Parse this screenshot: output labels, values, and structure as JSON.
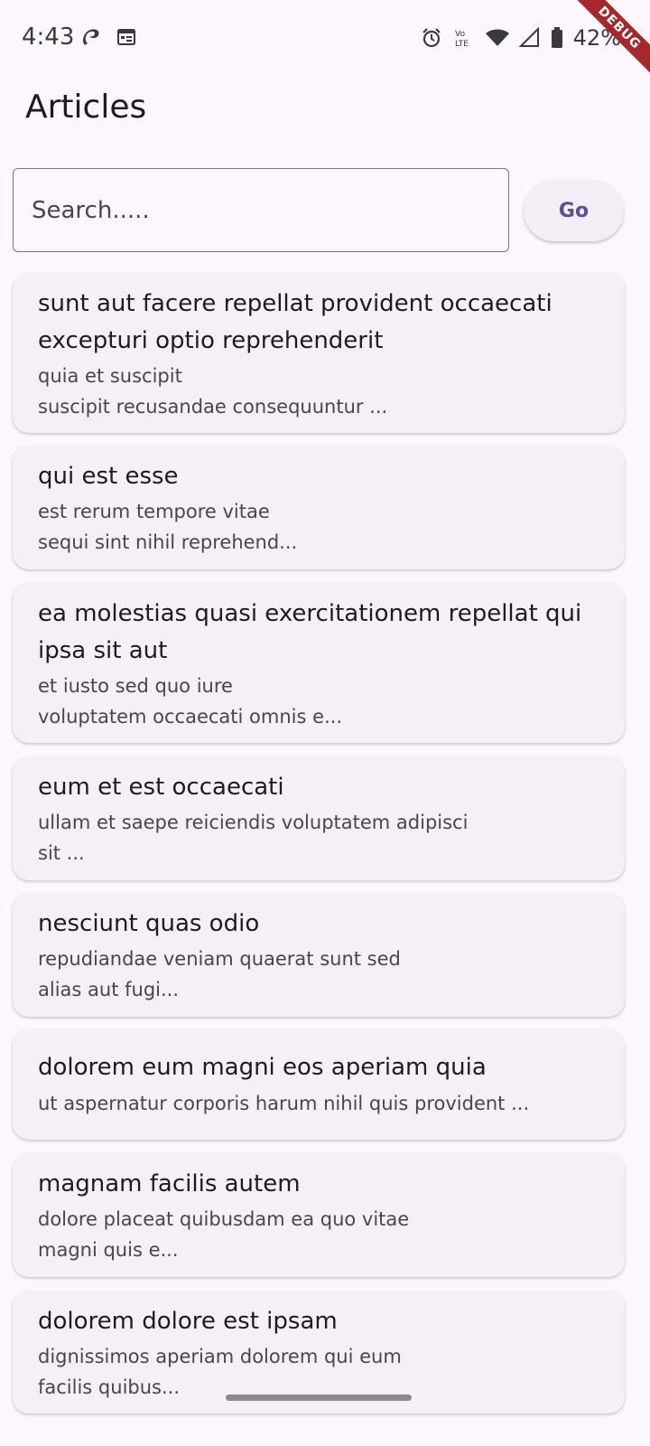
{
  "status_bar": {
    "time": "4:43",
    "battery": "42%",
    "debug_label": "DEBUG",
    "icons": [
      "airtel-icon",
      "calendar-icon",
      "alarm-icon",
      "volte-icon",
      "wifi-icon",
      "signal-icon",
      "battery-icon"
    ]
  },
  "app_bar": {
    "title": "Articles"
  },
  "search": {
    "placeholder": "Search.....",
    "value": "",
    "button_label": "Go"
  },
  "articles": [
    {
      "title": "sunt aut facere repellat provident occaecati excepturi optio reprehenderit",
      "body": "quia et suscipit\nsuscipit recusandae consequuntur ..."
    },
    {
      "title": "qui est esse",
      "body": "est rerum tempore vitae\nsequi sint nihil reprehend..."
    },
    {
      "title": "ea molestias quasi exercitationem repellat qui ipsa sit aut",
      "body": "et iusto sed quo iure\nvoluptatem occaecati omnis e..."
    },
    {
      "title": "eum et est occaecati",
      "body": "ullam et saepe reiciendis voluptatem adipisci\nsit ..."
    },
    {
      "title": "nesciunt quas odio",
      "body": "repudiandae veniam quaerat sunt sed\nalias aut fugi..."
    },
    {
      "title": "dolorem eum magni eos aperiam quia",
      "body": "ut aspernatur corporis harum nihil quis provident ..."
    },
    {
      "title": "magnam facilis autem",
      "body": "dolore placeat quibusdam ea quo vitae\nmagni quis e..."
    },
    {
      "title": "dolorem dolore est ipsam",
      "body": "dignissimos aperiam dolorem qui eum\nfacilis quibus..."
    }
  ]
}
